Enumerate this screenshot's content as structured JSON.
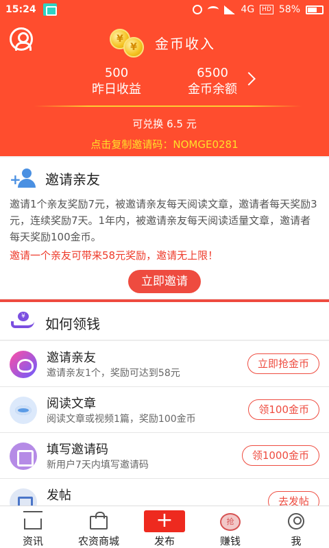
{
  "status_bar": {
    "time": "15:24",
    "network": "4G",
    "hd": "HD",
    "battery": "58%"
  },
  "header": {
    "title": "金币收入",
    "coin_symbol": "¥",
    "yesterday_value": "500",
    "yesterday_label": "昨日收益",
    "balance_value": "6500",
    "balance_label": "金币余额",
    "exchange_text": "可兑换 6.5 元",
    "invite_code_text": "点击复制邀请码：NOMGE0281"
  },
  "invite": {
    "title": "邀请亲友",
    "description": "邀请1个亲友奖励7元，被邀请亲友每天阅读文章，邀请者每天奖励3元，连续奖励7天。1年内，被邀请亲友每天阅读适量文章，邀请者每天奖励100金币。",
    "highlight": "邀请一个亲友可带来58元奖励，邀请无上限！",
    "button": "立即邀请"
  },
  "how": {
    "title": "如何领钱",
    "coin_symbol": "¥",
    "tasks": [
      {
        "title": "邀请亲友",
        "desc": "邀请亲友1个，奖励可达到58元",
        "button": "立即抢金币"
      },
      {
        "title": "阅读文章",
        "desc": "阅读文章或视频1篇，奖励100金币",
        "button": "领100金币"
      },
      {
        "title": "填写邀请码",
        "desc": "新用户7天内填写邀请码",
        "button": "领1000金币"
      },
      {
        "title": "发帖",
        "desc": "",
        "button": "去发帖"
      }
    ]
  },
  "nav": {
    "items": [
      {
        "label": "资讯"
      },
      {
        "label": "农资商城"
      },
      {
        "label": "发布",
        "icon_text": "+"
      },
      {
        "label": "赚钱",
        "icon_text": "抢"
      },
      {
        "label": "我"
      }
    ]
  },
  "colors": {
    "brand_red": "#ff4d2e",
    "button_red": "#ee4b3f",
    "code_yellow": "#ffe02a"
  }
}
